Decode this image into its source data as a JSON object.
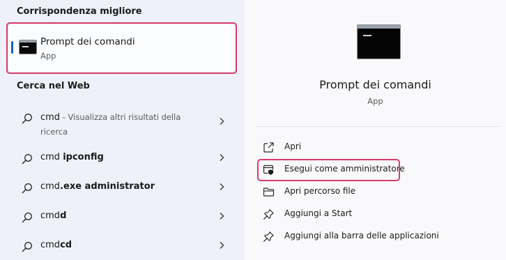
{
  "left_panel": {
    "best_match_title": "Corrispondenza migliore",
    "best_match": {
      "name": "Prompt dei comandi",
      "type": "App"
    },
    "web_title": "Cerca nel Web",
    "web_results": [
      {
        "query": "cmd",
        "suffix": " - Visualizza altri risultati della",
        "suffix2": "ricerca"
      },
      {
        "prefix": "cmd ",
        "bold": "ipconfig"
      },
      {
        "prefix": "cmd",
        "bold": ".exe administrator"
      },
      {
        "prefix": "cmd",
        "bold": "d"
      },
      {
        "prefix": "cmd",
        "bold": "cd"
      }
    ]
  },
  "right_panel": {
    "app_name": "Prompt dei comandi",
    "app_type": "App",
    "actions": [
      {
        "label": "Apri",
        "icon": "open-external-icon"
      },
      {
        "label": "Esegui come amministratore",
        "icon": "run-as-admin-shield-icon"
      },
      {
        "label": "Apri percorso file",
        "icon": "folder-icon"
      },
      {
        "label": "Aggiungi a Start",
        "icon": "pin-icon"
      },
      {
        "label": "Aggiungi alla barra delle applicazioni",
        "icon": "pin-icon"
      }
    ]
  },
  "colors": {
    "highlight": "#d63b6b",
    "accent": "#0a64c8",
    "left_bg": "#eef1f9",
    "right_bg": "#f9f9fb"
  }
}
